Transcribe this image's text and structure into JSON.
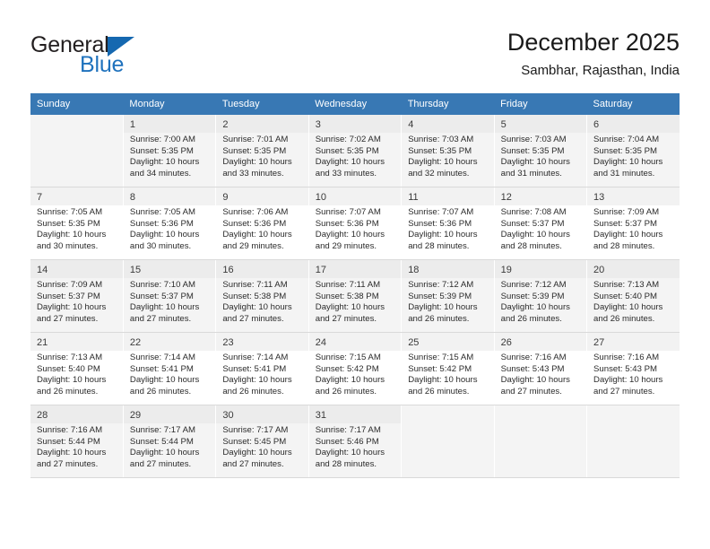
{
  "brand": {
    "name_part1": "General",
    "name_part2": "Blue",
    "accent_color": "#1568b0"
  },
  "header": {
    "title": "December 2025",
    "subtitle": "Sambhar, Rajasthan, India"
  },
  "calendar": {
    "header_bg": "#3878b4",
    "weekday_headers": [
      "Sunday",
      "Monday",
      "Tuesday",
      "Wednesday",
      "Thursday",
      "Friday",
      "Saturday"
    ],
    "weeks": [
      [
        {
          "day": "",
          "sunrise": "",
          "sunset": "",
          "daylight1": "",
          "daylight2": ""
        },
        {
          "day": "1",
          "sunrise": "Sunrise: 7:00 AM",
          "sunset": "Sunset: 5:35 PM",
          "daylight1": "Daylight: 10 hours",
          "daylight2": "and 34 minutes."
        },
        {
          "day": "2",
          "sunrise": "Sunrise: 7:01 AM",
          "sunset": "Sunset: 5:35 PM",
          "daylight1": "Daylight: 10 hours",
          "daylight2": "and 33 minutes."
        },
        {
          "day": "3",
          "sunrise": "Sunrise: 7:02 AM",
          "sunset": "Sunset: 5:35 PM",
          "daylight1": "Daylight: 10 hours",
          "daylight2": "and 33 minutes."
        },
        {
          "day": "4",
          "sunrise": "Sunrise: 7:03 AM",
          "sunset": "Sunset: 5:35 PM",
          "daylight1": "Daylight: 10 hours",
          "daylight2": "and 32 minutes."
        },
        {
          "day": "5",
          "sunrise": "Sunrise: 7:03 AM",
          "sunset": "Sunset: 5:35 PM",
          "daylight1": "Daylight: 10 hours",
          "daylight2": "and 31 minutes."
        },
        {
          "day": "6",
          "sunrise": "Sunrise: 7:04 AM",
          "sunset": "Sunset: 5:35 PM",
          "daylight1": "Daylight: 10 hours",
          "daylight2": "and 31 minutes."
        }
      ],
      [
        {
          "day": "7",
          "sunrise": "Sunrise: 7:05 AM",
          "sunset": "Sunset: 5:35 PM",
          "daylight1": "Daylight: 10 hours",
          "daylight2": "and 30 minutes."
        },
        {
          "day": "8",
          "sunrise": "Sunrise: 7:05 AM",
          "sunset": "Sunset: 5:36 PM",
          "daylight1": "Daylight: 10 hours",
          "daylight2": "and 30 minutes."
        },
        {
          "day": "9",
          "sunrise": "Sunrise: 7:06 AM",
          "sunset": "Sunset: 5:36 PM",
          "daylight1": "Daylight: 10 hours",
          "daylight2": "and 29 minutes."
        },
        {
          "day": "10",
          "sunrise": "Sunrise: 7:07 AM",
          "sunset": "Sunset: 5:36 PM",
          "daylight1": "Daylight: 10 hours",
          "daylight2": "and 29 minutes."
        },
        {
          "day": "11",
          "sunrise": "Sunrise: 7:07 AM",
          "sunset": "Sunset: 5:36 PM",
          "daylight1": "Daylight: 10 hours",
          "daylight2": "and 28 minutes."
        },
        {
          "day": "12",
          "sunrise": "Sunrise: 7:08 AM",
          "sunset": "Sunset: 5:37 PM",
          "daylight1": "Daylight: 10 hours",
          "daylight2": "and 28 minutes."
        },
        {
          "day": "13",
          "sunrise": "Sunrise: 7:09 AM",
          "sunset": "Sunset: 5:37 PM",
          "daylight1": "Daylight: 10 hours",
          "daylight2": "and 28 minutes."
        }
      ],
      [
        {
          "day": "14",
          "sunrise": "Sunrise: 7:09 AM",
          "sunset": "Sunset: 5:37 PM",
          "daylight1": "Daylight: 10 hours",
          "daylight2": "and 27 minutes."
        },
        {
          "day": "15",
          "sunrise": "Sunrise: 7:10 AM",
          "sunset": "Sunset: 5:37 PM",
          "daylight1": "Daylight: 10 hours",
          "daylight2": "and 27 minutes."
        },
        {
          "day": "16",
          "sunrise": "Sunrise: 7:11 AM",
          "sunset": "Sunset: 5:38 PM",
          "daylight1": "Daylight: 10 hours",
          "daylight2": "and 27 minutes."
        },
        {
          "day": "17",
          "sunrise": "Sunrise: 7:11 AM",
          "sunset": "Sunset: 5:38 PM",
          "daylight1": "Daylight: 10 hours",
          "daylight2": "and 27 minutes."
        },
        {
          "day": "18",
          "sunrise": "Sunrise: 7:12 AM",
          "sunset": "Sunset: 5:39 PM",
          "daylight1": "Daylight: 10 hours",
          "daylight2": "and 26 minutes."
        },
        {
          "day": "19",
          "sunrise": "Sunrise: 7:12 AM",
          "sunset": "Sunset: 5:39 PM",
          "daylight1": "Daylight: 10 hours",
          "daylight2": "and 26 minutes."
        },
        {
          "day": "20",
          "sunrise": "Sunrise: 7:13 AM",
          "sunset": "Sunset: 5:40 PM",
          "daylight1": "Daylight: 10 hours",
          "daylight2": "and 26 minutes."
        }
      ],
      [
        {
          "day": "21",
          "sunrise": "Sunrise: 7:13 AM",
          "sunset": "Sunset: 5:40 PM",
          "daylight1": "Daylight: 10 hours",
          "daylight2": "and 26 minutes."
        },
        {
          "day": "22",
          "sunrise": "Sunrise: 7:14 AM",
          "sunset": "Sunset: 5:41 PM",
          "daylight1": "Daylight: 10 hours",
          "daylight2": "and 26 minutes."
        },
        {
          "day": "23",
          "sunrise": "Sunrise: 7:14 AM",
          "sunset": "Sunset: 5:41 PM",
          "daylight1": "Daylight: 10 hours",
          "daylight2": "and 26 minutes."
        },
        {
          "day": "24",
          "sunrise": "Sunrise: 7:15 AM",
          "sunset": "Sunset: 5:42 PM",
          "daylight1": "Daylight: 10 hours",
          "daylight2": "and 26 minutes."
        },
        {
          "day": "25",
          "sunrise": "Sunrise: 7:15 AM",
          "sunset": "Sunset: 5:42 PM",
          "daylight1": "Daylight: 10 hours",
          "daylight2": "and 26 minutes."
        },
        {
          "day": "26",
          "sunrise": "Sunrise: 7:16 AM",
          "sunset": "Sunset: 5:43 PM",
          "daylight1": "Daylight: 10 hours",
          "daylight2": "and 27 minutes."
        },
        {
          "day": "27",
          "sunrise": "Sunrise: 7:16 AM",
          "sunset": "Sunset: 5:43 PM",
          "daylight1": "Daylight: 10 hours",
          "daylight2": "and 27 minutes."
        }
      ],
      [
        {
          "day": "28",
          "sunrise": "Sunrise: 7:16 AM",
          "sunset": "Sunset: 5:44 PM",
          "daylight1": "Daylight: 10 hours",
          "daylight2": "and 27 minutes."
        },
        {
          "day": "29",
          "sunrise": "Sunrise: 7:17 AM",
          "sunset": "Sunset: 5:44 PM",
          "daylight1": "Daylight: 10 hours",
          "daylight2": "and 27 minutes."
        },
        {
          "day": "30",
          "sunrise": "Sunrise: 7:17 AM",
          "sunset": "Sunset: 5:45 PM",
          "daylight1": "Daylight: 10 hours",
          "daylight2": "and 27 minutes."
        },
        {
          "day": "31",
          "sunrise": "Sunrise: 7:17 AM",
          "sunset": "Sunset: 5:46 PM",
          "daylight1": "Daylight: 10 hours",
          "daylight2": "and 28 minutes."
        },
        {
          "day": "",
          "sunrise": "",
          "sunset": "",
          "daylight1": "",
          "daylight2": ""
        },
        {
          "day": "",
          "sunrise": "",
          "sunset": "",
          "daylight1": "",
          "daylight2": ""
        },
        {
          "day": "",
          "sunrise": "",
          "sunset": "",
          "daylight1": "",
          "daylight2": ""
        }
      ]
    ]
  }
}
